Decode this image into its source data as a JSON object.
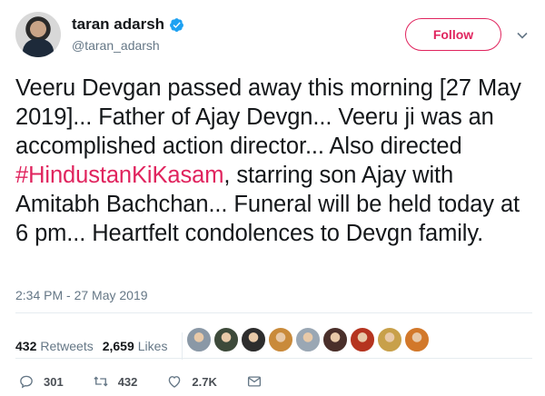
{
  "author": {
    "display_name": "taran adarsh",
    "handle": "@taran_adarsh",
    "verified": true
  },
  "follow_label": "Follow",
  "tweet": {
    "text_before": "Veeru Devgan passed away this morning [27 May 2019]... Father of Ajay Devgn... Veeru ji was an accomplished action director... Also directed ",
    "hashtag": "#HindustanKiKasam",
    "text_after": ", starring son Ajay with Amitabh Bachchan... Funeral will be held today at 6 pm... Heartfelt condolences to Devgn family.",
    "timestamp": "2:34 PM - 27 May 2019"
  },
  "stats": {
    "retweets_count": "432",
    "retweets_label": "Retweets",
    "likes_count": "2,659",
    "likes_label": "Likes"
  },
  "liker_avatars": [
    "#8a98a6",
    "#3d4a3a",
    "#2d2d2d",
    "#c98a3a",
    "#9aa7b4",
    "#4a2f2a",
    "#b5341f",
    "#c8a04a",
    "#d2782a"
  ],
  "actions": {
    "replies": "301",
    "retweets": "432",
    "likes": "2.7K"
  },
  "colors": {
    "accent": "#e0245e",
    "verified": "#1da1f2",
    "muted": "#657786"
  },
  "icons": [
    "verified-icon",
    "chevron-down-icon",
    "reply-icon",
    "retweet-icon",
    "like-icon",
    "message-icon"
  ]
}
